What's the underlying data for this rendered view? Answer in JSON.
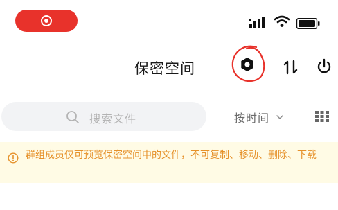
{
  "status_bar": {
    "recording_indicator": "record-icon",
    "signal_icon": "signal-icon",
    "wifi_icon": "wifi-icon",
    "battery_icon": "battery-icon"
  },
  "header": {
    "title": "保密空间",
    "settings_icon": "gear-icon",
    "sort_icon": "sort-arrows-icon",
    "exit_icon": "power-icon",
    "annotation_color": "#e8322b"
  },
  "toolbar": {
    "search_placeholder": "搜索文件",
    "sort_label": "按时间",
    "view_icon": "grid-view-icon"
  },
  "notice": {
    "text": "群组成员仅可预览保密空间中的文件，不可复制、移动、删除、下载",
    "icon": "info-circle-icon",
    "color": "#e6912a",
    "background": "#fffbe5"
  },
  "colors": {
    "accent": "#e8322b",
    "search_bg": "#f2f3f5"
  }
}
